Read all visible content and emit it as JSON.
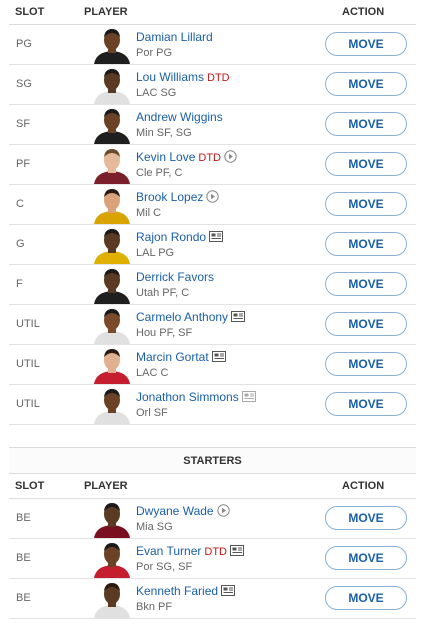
{
  "headers": {
    "slot": "SLOT",
    "player": "PLAYER",
    "action": "ACTION"
  },
  "move_label": "MOVE",
  "roster": [
    {
      "slot": "PG",
      "name": "Damian Lillard",
      "status": "",
      "icon": "",
      "meta": "Por  PG",
      "skin": "#6b4226",
      "jersey": "#1f1f1f",
      "hair": "#1a1a1a"
    },
    {
      "slot": "SG",
      "name": "Lou Williams",
      "status": "DTD",
      "icon": "",
      "meta": "LAC  SG",
      "skin": "#5a3a22",
      "jersey": "#e0e0e0",
      "hair": "#1a1a1a"
    },
    {
      "slot": "SF",
      "name": "Andrew Wiggins",
      "status": "",
      "icon": "",
      "meta": "Min  SF, SG",
      "skin": "#6b4226",
      "jersey": "#1f1f1f",
      "hair": "#1a1a1a"
    },
    {
      "slot": "PF",
      "name": "Kevin Love",
      "status": "DTD",
      "icon": "play",
      "meta": "Cle  PF, C",
      "skin": "#e6b99b",
      "jersey": "#7a1f2b",
      "hair": "#6b4b2a"
    },
    {
      "slot": "C",
      "name": "Brook Lopez",
      "status": "",
      "icon": "play",
      "meta": "Mil  C",
      "skin": "#d9a27a",
      "jersey": "#d9a400",
      "hair": "#2a1a10"
    },
    {
      "slot": "G",
      "name": "Rajon Rondo",
      "status": "",
      "icon": "news",
      "meta": "LAL  PG",
      "skin": "#5a3a22",
      "jersey": "#e0b000",
      "hair": "#1a1a1a"
    },
    {
      "slot": "F",
      "name": "Derrick Favors",
      "status": "",
      "icon": "",
      "meta": "Utah  PF, C",
      "skin": "#5a3a22",
      "jersey": "#1f1f1f",
      "hair": "#1a1a1a"
    },
    {
      "slot": "UTIL",
      "name": "Carmelo Anthony",
      "status": "",
      "icon": "news",
      "meta": "Hou  PF, SF",
      "skin": "#7a4a2a",
      "jersey": "#e0e0e0",
      "hair": "#1a1a1a"
    },
    {
      "slot": "UTIL",
      "name": "Marcin Gortat",
      "status": "",
      "icon": "news",
      "meta": "LAC  C",
      "skin": "#e0b090",
      "jersey": "#c41e2f",
      "hair": "#2a1a10"
    },
    {
      "slot": "UTIL",
      "name": "Jonathon Simmons",
      "status": "",
      "icon": "news-gray",
      "meta": "Orl  SF",
      "skin": "#6b4226",
      "jersey": "#e0e0e0",
      "hair": "#1a1a1a"
    }
  ],
  "bench_group_label": "STARTERS",
  "bench": [
    {
      "slot": "BE",
      "name": "Dwyane Wade",
      "status": "",
      "icon": "play",
      "meta": "Mia  SG",
      "skin": "#5a3a22",
      "jersey": "#7a0f1f",
      "hair": "#1a1a1a"
    },
    {
      "slot": "BE",
      "name": "Evan Turner",
      "status": "DTD",
      "icon": "news",
      "meta": "Por  SG, SF",
      "skin": "#6b4226",
      "jersey": "#c41e2f",
      "hair": "#1a1a1a"
    },
    {
      "slot": "BE",
      "name": "Kenneth Faried",
      "status": "",
      "icon": "news",
      "meta": "Bkn  PF",
      "skin": "#5a3a22",
      "jersey": "#e0e0e0",
      "hair": "#2a1a10"
    }
  ]
}
